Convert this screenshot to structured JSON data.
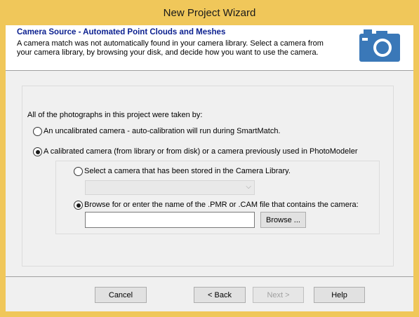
{
  "window": {
    "title": "New Project Wizard"
  },
  "header": {
    "title": "Camera Source - Automated Point Clouds and Meshes",
    "description": "A camera match was not automatically found in your camera library. Select a camera from your camera library, by browsing your disk, and decide how you want to use the camera.",
    "icon": "camera-icon",
    "icon_color": "#3a78b8"
  },
  "form": {
    "intro_label": "All of the photographs in this project were taken by:",
    "radio_uncalibrated": {
      "label": "An uncalibrated camera - auto-calibration will run during SmartMatch.",
      "checked": false
    },
    "radio_calibrated": {
      "label": "A calibrated camera (from library or from disk) or a camera previously used in PhotoModeler",
      "checked": true
    },
    "radio_library": {
      "label": "Select a camera that has been stored in the Camera Library.",
      "checked": false
    },
    "library_select_value": "",
    "radio_browse": {
      "label": "Browse for or enter the name of the .PMR or .CAM file that contains the camera:",
      "checked": true
    },
    "browse_path_value": "",
    "browse_button": "Browse ..."
  },
  "footer": {
    "cancel": "Cancel",
    "back": "< Back",
    "next": "Next >",
    "help": "Help"
  }
}
